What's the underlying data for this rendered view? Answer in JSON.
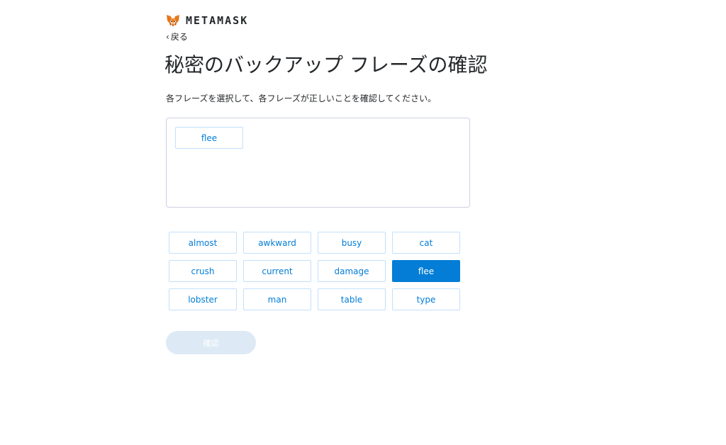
{
  "header": {
    "logo_text": "METAMASK",
    "logo_icon": "metamask-fox-icon"
  },
  "nav": {
    "back_label": "戻る"
  },
  "main": {
    "title": "秘密のバックアップ フレーズの確認",
    "instruction": "各フレーズを選択して、各フレーズが正しいことを確認してください。",
    "selected_words": [
      "flee"
    ],
    "word_options": [
      {
        "label": "almost",
        "selected": false
      },
      {
        "label": "awkward",
        "selected": false
      },
      {
        "label": "busy",
        "selected": false
      },
      {
        "label": "cat",
        "selected": false
      },
      {
        "label": "crush",
        "selected": false
      },
      {
        "label": "current",
        "selected": false
      },
      {
        "label": "damage",
        "selected": false
      },
      {
        "label": "flee",
        "selected": true
      },
      {
        "label": "lobster",
        "selected": false
      },
      {
        "label": "man",
        "selected": false
      },
      {
        "label": "table",
        "selected": false
      },
      {
        "label": "type",
        "selected": false
      }
    ],
    "confirm_label": "確認"
  },
  "colors": {
    "accent": "#037dd6",
    "chip_border": "#c3e0fb",
    "disabled_button": "#ddeaf6",
    "text": "#24272a"
  }
}
